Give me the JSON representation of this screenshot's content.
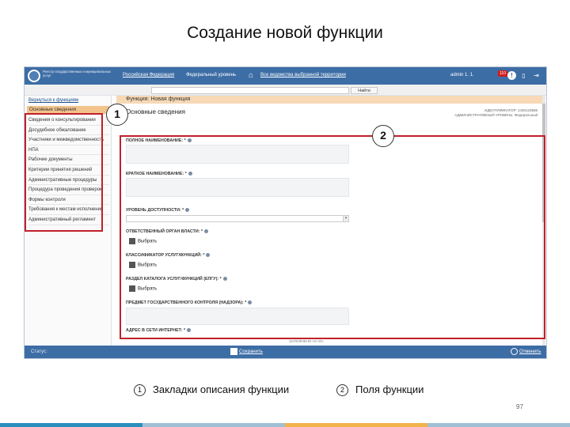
{
  "slide": {
    "title": "Создание новой функции",
    "page_number": "97",
    "legend": [
      {
        "num": "1",
        "text": "Закладки описания функции"
      },
      {
        "num": "2",
        "text": "Поля функции"
      }
    ],
    "callouts": [
      "1",
      "2"
    ]
  },
  "app": {
    "topbar": {
      "org_name": "Реестр государственных и муниципальных услуг",
      "nav_1": "Российская Федерация",
      "nav_2": "Федеральный уровень",
      "nav_3": "Все ведомства выбранной территории",
      "user": "admin 1. 1.",
      "badge": "110"
    },
    "search": {
      "placeholder": "",
      "button_label": "Найти"
    },
    "sidebar": {
      "back_link": "Вернуться к функциям",
      "section_label": "Основные сведения",
      "items": [
        "Сведения о консультировании",
        "Досудебное обжалование",
        "Участники и межведомственность",
        "НПА",
        "Рабочие документы",
        "Критерии принятия решений",
        "Административные процедуры",
        "Процедура проведения проверок",
        "Формы контроля",
        "Требования к местам исполнения",
        "Административный регламент"
      ]
    },
    "form": {
      "header_prefix": "Функция: ",
      "header_name": "Новая функция",
      "section_title": "Основные сведения",
      "meta_line_1": "ИДЕНТИФИКАТОР: 1430123565",
      "meta_line_2": "АДМИНИСТРАТИВНЫЙ УРОВЕНЬ: Федеральный",
      "fields": {
        "full_name": "ПОЛНОЕ НАИМЕНОВАНИЕ: *",
        "short_name": "КРАТКОЕ НАИМЕНОВАНИЕ: *",
        "access_level": "УРОВЕНЬ ДОСТУПНОСТИ: *",
        "responsible_body": "ОТВЕТСТВЕННЫЙ ОРГАН ВЛАСТИ: *",
        "classifier": "КЛАССИФИКАТОР УСЛУГ/ФУНКЦИЙ: *",
        "catalog_section": "РАЗДЕЛ КАТАЛОГА УСЛУГ/ФУНКЦИЙ (ЕПГУ): *",
        "control_subject": "ПРЕДМЕТ ГОСУДАРСТВЕННОГО КОНТРОЛЯ (НАДЗОРА): *",
        "address": "АДРЕС В СЕТИ ИНТЕРНЕТ: *"
      },
      "pick_label": "Выбрать",
      "filled_note": "ЗАПОЛНЕНО НА 0%"
    },
    "bottombar": {
      "status": "Статус:",
      "save": "Сохранить",
      "cancel": "Отменить"
    }
  },
  "colors": {
    "topbar": "#3d6da5",
    "highlight": "#c0202b",
    "sidebar_active": "#f3c38c",
    "form_header": "#f7d9b6"
  }
}
